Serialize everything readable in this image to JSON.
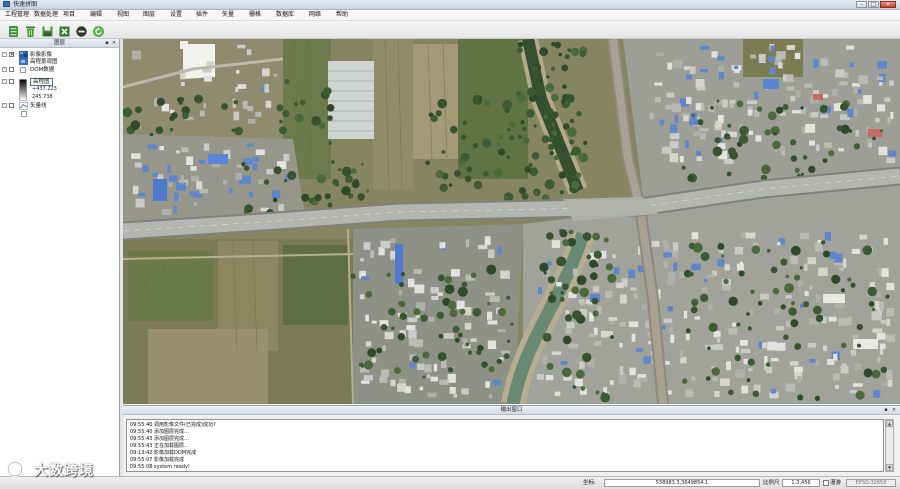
{
  "window": {
    "title": "快速拼图"
  },
  "menu": [
    {
      "label": "工程管理"
    },
    {
      "label": "数据处理"
    },
    {
      "label": "项目"
    },
    {
      "label": "编辑"
    },
    {
      "label": "视图"
    },
    {
      "label": "图层"
    },
    {
      "label": "设置"
    },
    {
      "label": "插件"
    },
    {
      "label": "矢量"
    },
    {
      "label": "栅格"
    },
    {
      "label": "数据库"
    },
    {
      "label": "网络"
    },
    {
      "label": "帮助"
    }
  ],
  "toolbar": [
    {
      "icon": "layers-icon"
    },
    {
      "icon": "delete-icon"
    },
    {
      "icon": "save-icon"
    },
    {
      "icon": "export-excel-icon"
    },
    {
      "icon": "stop-icon"
    },
    {
      "icon": "refresh-icon"
    }
  ],
  "layers_panel": {
    "title": "图层",
    "items": [
      {
        "label": "影像影像",
        "sub": "高程景观图"
      },
      {
        "label": "DOM数据"
      },
      {
        "label": "高程图",
        "max": "+437.223",
        "min": "245.738"
      },
      {
        "label": "矢量线"
      }
    ]
  },
  "output_panel": {
    "title": "输出窗口",
    "logs": [
      "09:55:40 调用影像文件(已完成)成功?",
      "09:55:40 添加图层完成...",
      "09:55:43 添加图层完成...",
      "09:55:43 正在加载图层...",
      "09:13:42 影像加载DOM完成",
      "09:55:07 影像加载完成",
      "09:55:08 system ready!"
    ]
  },
  "status_bar": {
    "coord_label": "坐标:",
    "coord_value": "538983.3,3649854.1",
    "scale_label": "比例尺",
    "scale_value": "1:3,456",
    "roam_label": "漫游",
    "crs": "EPSG:32650"
  },
  "watermark": "大数跨境",
  "colors": {
    "accent": "#3d6fb3",
    "close": "#c9432f",
    "icon_green": "#4a9a3a"
  }
}
